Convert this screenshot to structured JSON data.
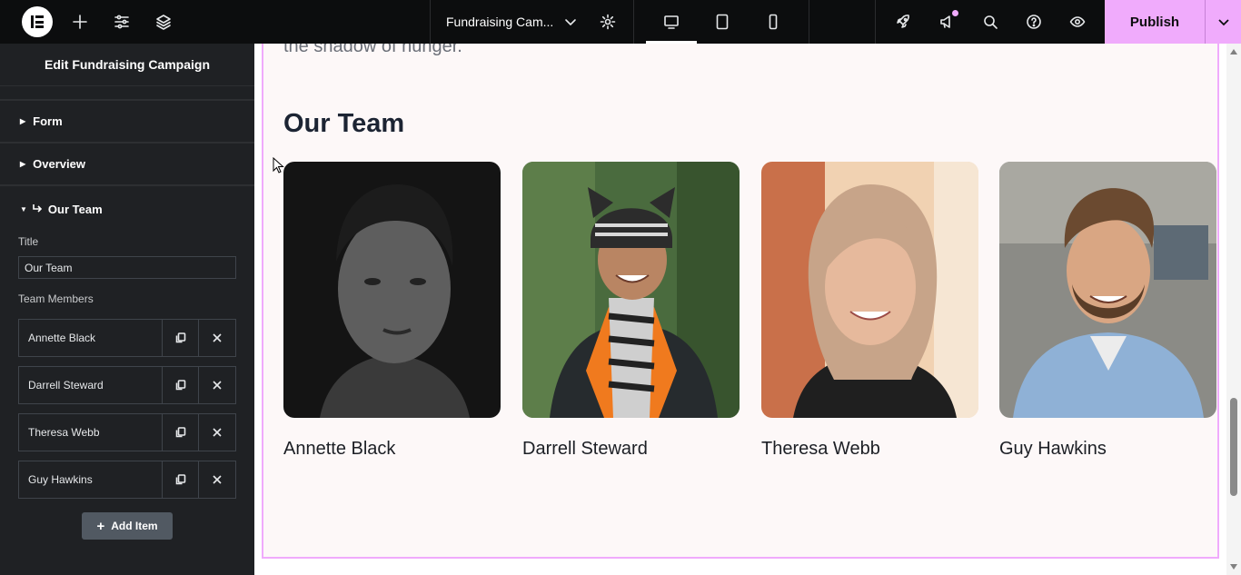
{
  "topbar": {
    "page_title": "Fundraising Cam...",
    "publish_label": "Publish",
    "accent_color": "#f0abfc"
  },
  "sidebar": {
    "header": "Edit Fundraising Campaign",
    "sections": [
      {
        "label": "Form"
      },
      {
        "label": "Overview"
      }
    ],
    "open_section": {
      "label": "Our Team",
      "title_field_label": "Title",
      "title_value": "Our Team",
      "members_label": "Team Members",
      "members": [
        "Annette Black",
        "Darrell Steward",
        "Theresa Webb",
        "Guy Hawkins"
      ],
      "add_item_label": "Add Item"
    }
  },
  "canvas": {
    "intro_text": "the shadow of hunger.",
    "heading": "Our Team",
    "members": [
      {
        "name": "Annette Black"
      },
      {
        "name": "Darrell Steward"
      },
      {
        "name": "Theresa Webb"
      },
      {
        "name": "Guy Hawkins"
      }
    ]
  }
}
